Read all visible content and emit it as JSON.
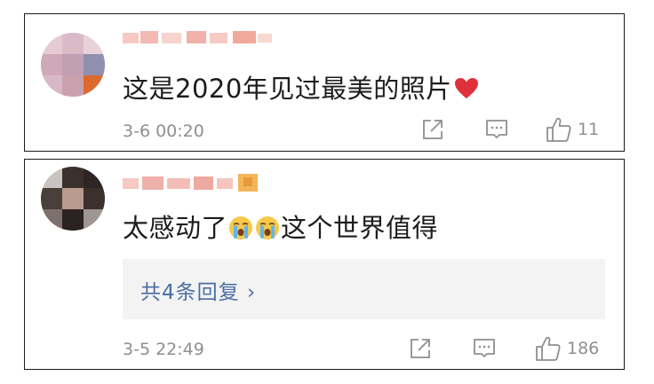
{
  "comments": [
    {
      "text": "这是2020年见过最美的照片",
      "emoji_after": "heart",
      "time": "3-6 00:20",
      "likes": "11",
      "icons": {
        "share": "share-icon",
        "comment": "comment-icon",
        "like": "thumbs-up-icon"
      }
    },
    {
      "text_part1": "太感动了",
      "text_part2": "这个世界值得",
      "emoji_middle": [
        "crying-face",
        "crying-face"
      ],
      "time": "3-5 22:49",
      "likes": "186",
      "reply_label": "共4条回复 ›",
      "icons": {
        "share": "share-icon",
        "comment": "comment-icon",
        "like": "thumbs-up-icon"
      }
    }
  ],
  "colors": {
    "reply_link": "#4a6ea3",
    "meta_gray": "#8f8f8f",
    "heart_red": "#e0303b",
    "reply_bg": "#f3f3f3"
  }
}
